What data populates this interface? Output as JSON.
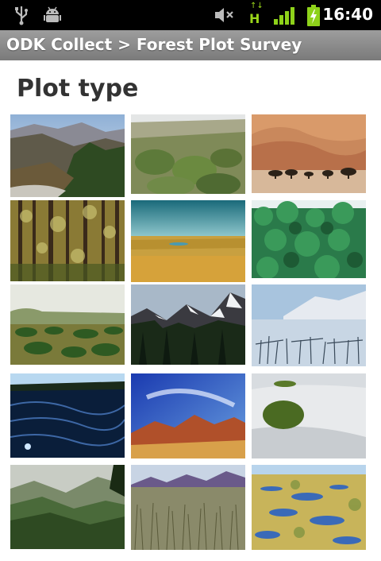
{
  "status_bar": {
    "time": "16:40",
    "icons": [
      "usb-icon",
      "android-debug-icon",
      "mute-icon",
      "hspa-data-icon",
      "signal-icon",
      "battery-charging-icon"
    ],
    "network_label": "H"
  },
  "title_bar": {
    "title": "ODK Collect > Forest Plot Survey"
  },
  "question": {
    "label": "Plot type"
  },
  "choices": [
    {
      "name": "mountain-forest-valley"
    },
    {
      "name": "shrubland"
    },
    {
      "name": "desert-dunes-savanna"
    },
    {
      "name": "woodland"
    },
    {
      "name": "grassland"
    },
    {
      "name": "tropical-forest"
    },
    {
      "name": "savanna"
    },
    {
      "name": "alpine-conifer"
    },
    {
      "name": "tundra"
    },
    {
      "name": "ocean-coast"
    },
    {
      "name": "red-desert-mountains"
    },
    {
      "name": "sand-dune-shrub"
    },
    {
      "name": "misty-mountain-forest"
    },
    {
      "name": "steppe-grassland"
    },
    {
      "name": "wetland"
    }
  ]
}
